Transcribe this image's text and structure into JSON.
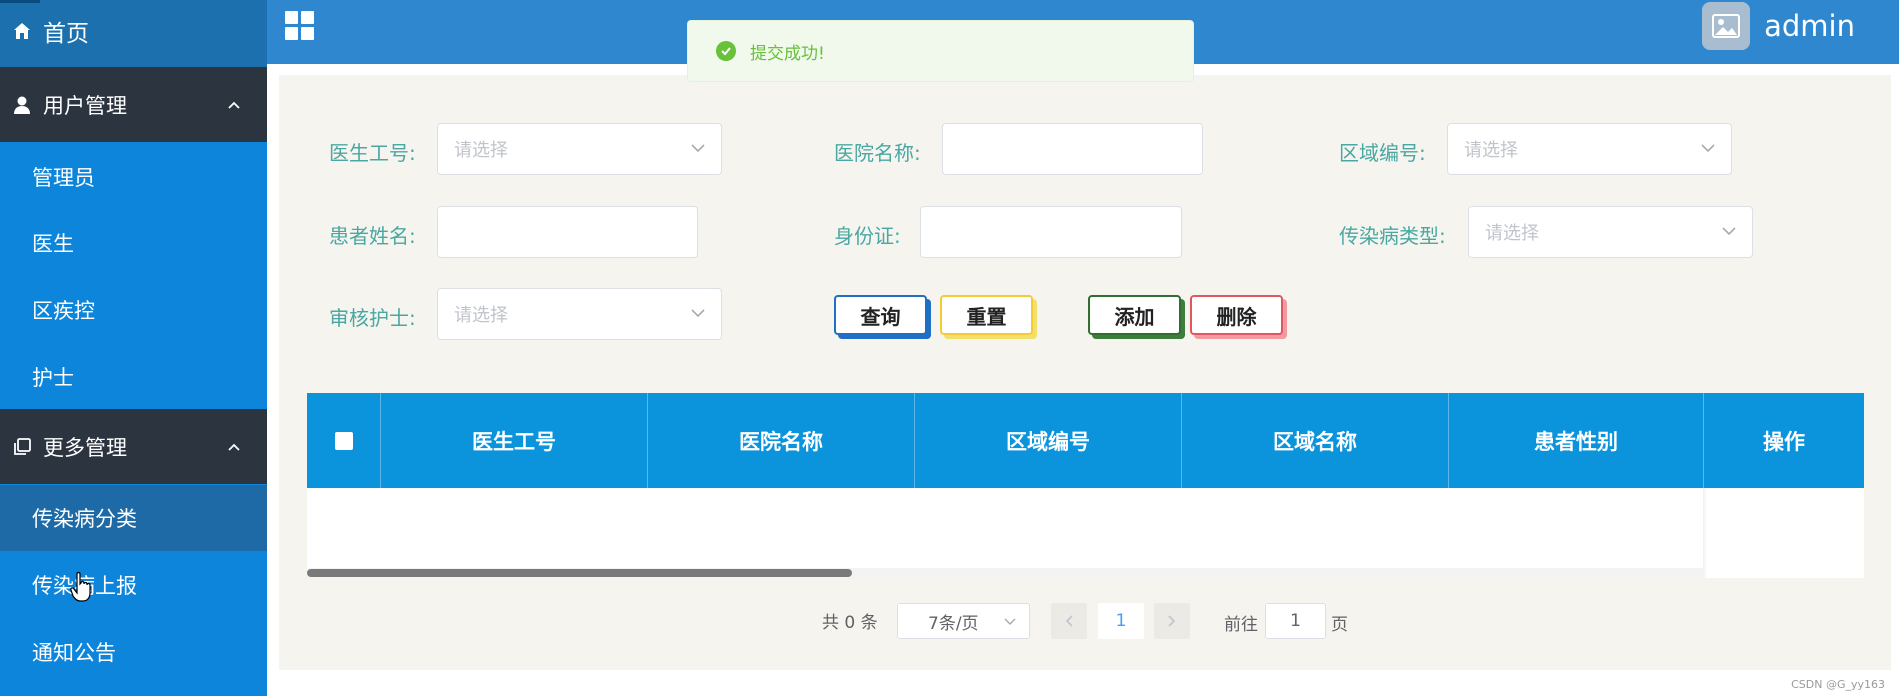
{
  "sidebar": {
    "home": "首页",
    "group_user": "用户管理",
    "user_items": [
      "管理员",
      "医生",
      "区疾控",
      "护士"
    ],
    "group_more": "更多管理",
    "more_items": [
      "传染病分类",
      "传染病上报",
      "通知公告"
    ],
    "active_item": "传染病分类"
  },
  "header": {
    "username": "admin"
  },
  "toast": {
    "message": "提交成功!"
  },
  "filters": {
    "doctor_id_label": "医生工号:",
    "doctor_id_placeholder": "请选择",
    "hospital_name_label": "医院名称:",
    "hospital_name_value": "",
    "region_code_label": "区域编号:",
    "region_code_placeholder": "请选择",
    "patient_name_label": "患者姓名:",
    "patient_name_value": "",
    "id_card_label": "身份证:",
    "id_card_value": "",
    "disease_type_label": "传染病类型:",
    "disease_type_placeholder": "请选择",
    "nurse_label": "审核护士:",
    "nurse_placeholder": "请选择"
  },
  "buttons": {
    "query": "查询",
    "reset": "重置",
    "add": "添加",
    "delete": "删除"
  },
  "colors": {
    "query_border": "#1f6fc4",
    "reset_border": "#f2cb35",
    "add_border": "#2f6f2f",
    "delete_border": "#e0585f"
  },
  "table": {
    "columns": [
      "医生工号",
      "医院名称",
      "区域编号",
      "区域名称",
      "患者性别",
      "操作"
    ],
    "rows": []
  },
  "pagination": {
    "total_text": "共 0 条",
    "page_size": "7条/页",
    "current_page": "1",
    "goto_label": "前往",
    "goto_value": "1",
    "page_suffix": "页"
  },
  "watermark": "CSDN @G_yy163"
}
